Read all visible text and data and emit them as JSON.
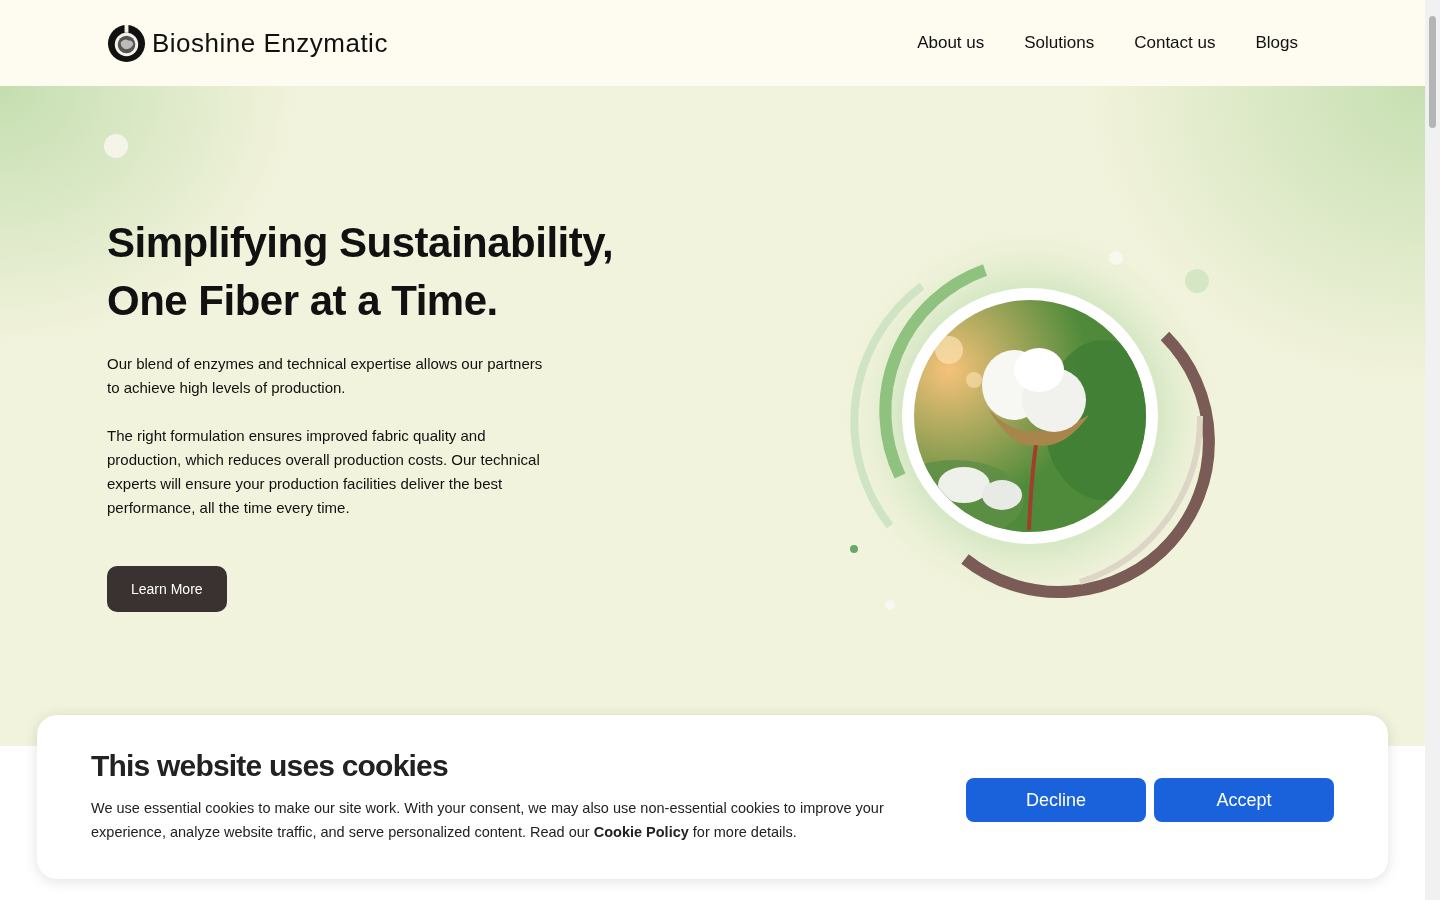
{
  "header": {
    "brand": "Bioshine Enzymatic",
    "nav": [
      "About us",
      "Solutions",
      "Contact us",
      "Blogs"
    ]
  },
  "hero": {
    "title_lines": [
      "Simplifying Sustainability,",
      "One Fiber at a Time."
    ],
    "paragraphs": [
      "Our blend of enzymes and technical expertise allows our partners to achieve high levels of production.",
      "The right formulation ensures improved fabric quality and production, which reduces overall production costs. Our technical experts will ensure your production facilities deliver the best performance, all the time every time."
    ],
    "button": "Learn More"
  },
  "cookie_banner": {
    "title": "This website uses cookies",
    "text": "We use essential cookies to make our site work. With your consent, we may also use non-essential cookies to improve your experience, analyze website traffic, and serve personalized content. Read our **Cookie Policy** for more details.",
    "buttons": [
      "Decline",
      "Accept"
    ]
  }
}
